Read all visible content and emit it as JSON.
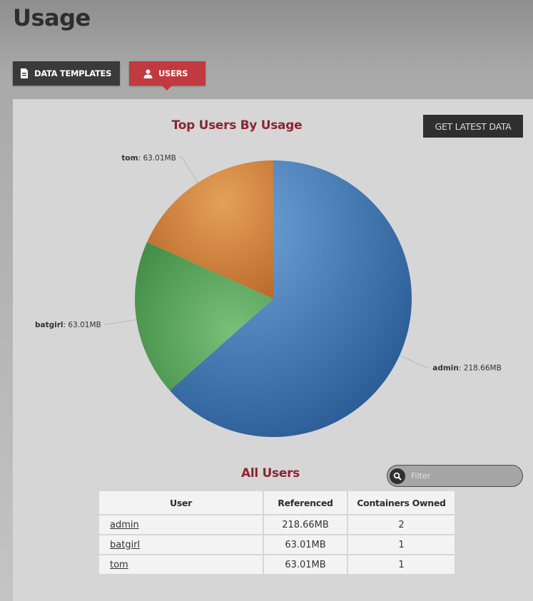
{
  "page": {
    "title": "Usage"
  },
  "tabs": [
    {
      "label": "DATA TEMPLATES",
      "icon": "document-icon",
      "active": false
    },
    {
      "label": "USERS",
      "icon": "user-icon",
      "active": true
    }
  ],
  "chart": {
    "get_latest_label": "GET LATEST DATA"
  },
  "chart_data": {
    "type": "pie",
    "title": "Top Users By Usage",
    "unit": "MB",
    "slices": [
      {
        "name": "admin",
        "value": 218.66,
        "label": "218.66MB",
        "color": "#3d6fa8"
      },
      {
        "name": "batgirl",
        "value": 63.01,
        "label": "63.01MB",
        "color": "#5aa55d"
      },
      {
        "name": "tom",
        "value": 63.01,
        "label": "63.01MB",
        "color": "#d07f35"
      }
    ]
  },
  "users_section": {
    "title": "All Users",
    "filter_placeholder": "Filter",
    "columns": [
      "User",
      "Referenced",
      "Containers Owned"
    ],
    "rows": [
      {
        "user": "admin",
        "referenced": "218.66MB",
        "containers": "2"
      },
      {
        "user": "batgirl",
        "referenced": "63.01MB",
        "containers": "1"
      },
      {
        "user": "tom",
        "referenced": "63.01MB",
        "containers": "1"
      }
    ]
  }
}
